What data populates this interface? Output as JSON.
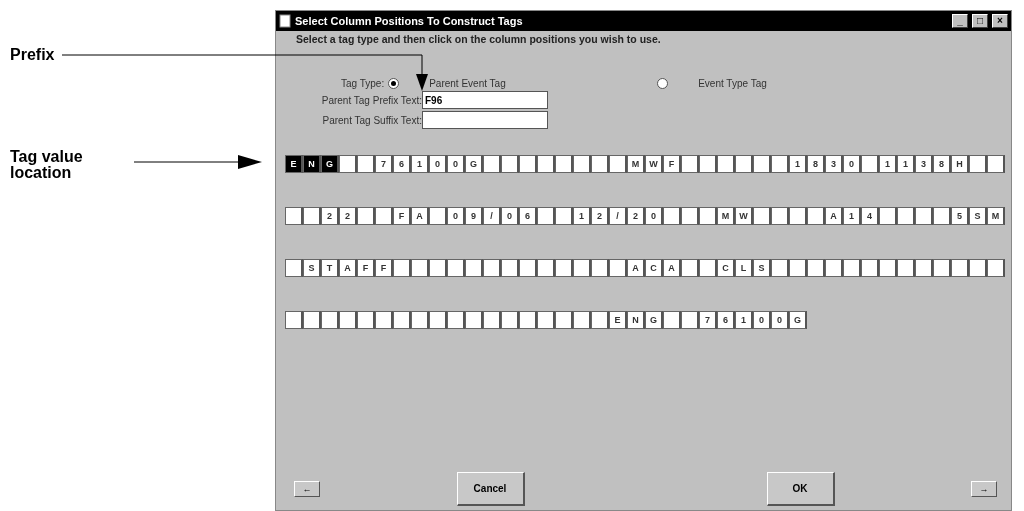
{
  "annotations": [
    {
      "kind": "down",
      "label": "Prefix"
    },
    {
      "kind": "right",
      "label": "Tag value location"
    }
  ],
  "window": {
    "title": "Select Column Positions To Construct Tags",
    "controls": [
      "_",
      "□",
      "×"
    ]
  },
  "instruction": "Select a tag type and then click on the column positions you wish to use.",
  "tag_type": {
    "label": "Tag Type:",
    "options": [
      {
        "label": "Parent Event Tag",
        "selected": true
      },
      {
        "label": "Event Type Tag",
        "selected": false
      }
    ]
  },
  "fields": [
    {
      "label": "Parent Tag Prefix Text:",
      "value": "F96"
    },
    {
      "label": "Parent Tag Suffix Text:"
    }
  ],
  "rows": [
    {
      "cells": [
        {
          "char": "E",
          "selected": true
        },
        {
          "char": "N",
          "selected": true
        },
        {
          "char": "G",
          "selected": true
        },
        {
          "selected": false
        },
        {
          "selected": false
        },
        {
          "char": "7",
          "selected": false
        },
        {
          "char": "6",
          "selected": false
        },
        {
          "char": "1",
          "selected": false
        },
        {
          "char": "0",
          "selected": false
        },
        {
          "char": "0",
          "selected": false
        },
        {
          "char": "G",
          "selected": false
        },
        {
          "selected": false
        },
        {
          "selected": false
        },
        {
          "selected": false
        },
        {
          "selected": false
        },
        {
          "selected": false
        },
        {
          "selected": false
        },
        {
          "selected": false
        },
        {
          "selected": false
        },
        {
          "char": "M",
          "selected": false
        },
        {
          "char": "W",
          "selected": false
        },
        {
          "char": "F",
          "selected": false
        },
        {
          "selected": false
        },
        {
          "selected": false
        },
        {
          "selected": false
        },
        {
          "selected": false
        },
        {
          "selected": false
        },
        {
          "selected": false
        },
        {
          "char": "1",
          "selected": false
        },
        {
          "char": "8",
          "selected": false
        },
        {
          "char": "3",
          "selected": false
        },
        {
          "char": "0",
          "selected": false
        },
        {
          "selected": false
        },
        {
          "char": "1",
          "selected": false
        },
        {
          "char": "1",
          "selected": false
        },
        {
          "char": "3",
          "selected": false
        },
        {
          "char": "8",
          "selected": false
        },
        {
          "char": "H",
          "selected": false
        },
        {
          "selected": false
        },
        {
          "selected": false
        }
      ]
    },
    {
      "cells": [
        {
          "selected": false
        },
        {
          "selected": false
        },
        {
          "char": "2",
          "selected": false
        },
        {
          "char": "2",
          "selected": false
        },
        {
          "selected": false
        },
        {
          "selected": false
        },
        {
          "char": "F",
          "selected": false
        },
        {
          "char": "A",
          "selected": false
        },
        {
          "selected": false
        },
        {
          "char": "0",
          "selected": false
        },
        {
          "char": "9",
          "selected": false
        },
        {
          "char": "/",
          "selected": false
        },
        {
          "char": "0",
          "selected": false
        },
        {
          "char": "6",
          "selected": false
        },
        {
          "selected": false
        },
        {
          "selected": false
        },
        {
          "char": "1",
          "selected": false
        },
        {
          "char": "2",
          "selected": false
        },
        {
          "char": "/",
          "selected": false
        },
        {
          "char": "2",
          "selected": false
        },
        {
          "char": "0",
          "selected": false
        },
        {
          "selected": false
        },
        {
          "selected": false
        },
        {
          "selected": false
        },
        {
          "char": "M",
          "selected": false
        },
        {
          "char": "W",
          "selected": false
        },
        {
          "selected": false
        },
        {
          "selected": false
        },
        {
          "selected": false
        },
        {
          "selected": false
        },
        {
          "char": "A",
          "selected": false
        },
        {
          "char": "1",
          "selected": false
        },
        {
          "char": "4",
          "selected": false
        },
        {
          "selected": false
        },
        {
          "selected": false
        },
        {
          "selected": false
        },
        {
          "selected": false
        },
        {
          "char": "5",
          "selected": false
        },
        {
          "char": "S",
          "selected": false
        },
        {
          "char": "M",
          "selected": false
        }
      ]
    },
    {
      "cells": [
        {
          "selected": false
        },
        {
          "char": "S",
          "selected": false
        },
        {
          "char": "T",
          "selected": false
        },
        {
          "char": "A",
          "selected": false
        },
        {
          "char": "F",
          "selected": false
        },
        {
          "char": "F",
          "selected": false
        },
        {
          "selected": false
        },
        {
          "selected": false
        },
        {
          "selected": false
        },
        {
          "selected": false
        },
        {
          "selected": false
        },
        {
          "selected": false
        },
        {
          "selected": false
        },
        {
          "selected": false
        },
        {
          "selected": false
        },
        {
          "selected": false
        },
        {
          "selected": false
        },
        {
          "selected": false
        },
        {
          "selected": false
        },
        {
          "char": "A",
          "selected": false
        },
        {
          "char": "C",
          "selected": false
        },
        {
          "char": "A",
          "selected": false
        },
        {
          "selected": false
        },
        {
          "selected": false
        },
        {
          "char": "C",
          "selected": false
        },
        {
          "char": "L",
          "selected": false
        },
        {
          "char": "S",
          "selected": false
        },
        {
          "selected": false
        },
        {
          "selected": false
        },
        {
          "selected": false
        },
        {
          "selected": false
        },
        {
          "selected": false
        },
        {
          "selected": false
        },
        {
          "selected": false
        },
        {
          "selected": false
        },
        {
          "selected": false
        },
        {
          "selected": false
        },
        {
          "selected": false
        },
        {
          "selected": false
        },
        {
          "selected": false
        }
      ]
    },
    {
      "cells": [
        {
          "selected": false
        },
        {
          "selected": false
        },
        {
          "selected": false
        },
        {
          "selected": false
        },
        {
          "selected": false
        },
        {
          "selected": false
        },
        {
          "selected": false
        },
        {
          "selected": false
        },
        {
          "selected": false
        },
        {
          "selected": false
        },
        {
          "selected": false
        },
        {
          "selected": false
        },
        {
          "selected": false
        },
        {
          "selected": false
        },
        {
          "selected": false
        },
        {
          "selected": false
        },
        {
          "selected": false
        },
        {
          "selected": false
        },
        {
          "char": "E",
          "selected": false
        },
        {
          "char": "N",
          "selected": false
        },
        {
          "char": "G",
          "selected": false
        },
        {
          "selected": false
        },
        {
          "selected": false
        },
        {
          "char": "7",
          "selected": false
        },
        {
          "char": "6",
          "selected": false
        },
        {
          "char": "1",
          "selected": false
        },
        {
          "char": "0",
          "selected": false
        },
        {
          "char": "0",
          "selected": false
        },
        {
          "char": "G",
          "selected": false
        }
      ]
    }
  ],
  "buttons": [
    {
      "kind": "arrow",
      "label": "←"
    },
    {
      "kind": "text",
      "label": "Cancel"
    },
    {
      "kind": "text",
      "label": "OK"
    },
    {
      "kind": "arrow",
      "label": "→"
    }
  ]
}
